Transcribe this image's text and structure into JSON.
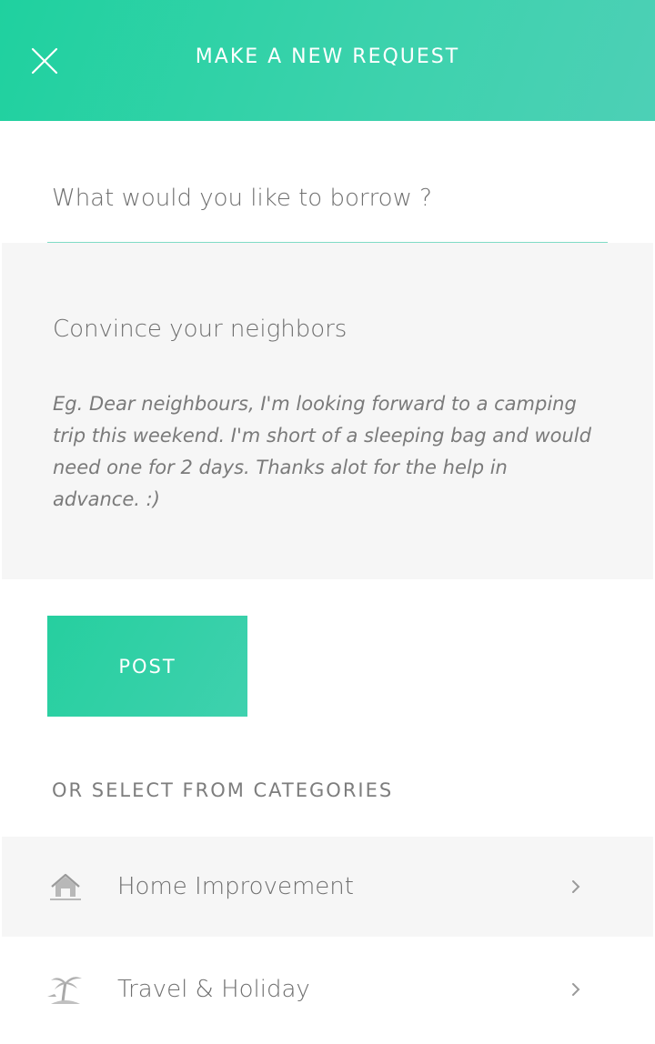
{
  "header": {
    "title": "MAKE A NEW REQUEST",
    "close_icon": "close-icon",
    "gradient_start": "#1fd19f",
    "gradient_end": "#4dd0b6"
  },
  "form": {
    "borrow_placeholder": "What would you like to borrow ?",
    "borrow_value": "",
    "message_title": "Convince your neighbors",
    "message_placeholder": "Eg. Dear neighbours, I'm looking forward to a camping trip this weekend. I'm short of a sleeping bag and would need one for 2 days. Thanks alot for the help in advance. :)",
    "post_label": "POST"
  },
  "categories": {
    "heading": "OR SELECT FROM CATEGORIES",
    "items": [
      {
        "label": "Home Improvement",
        "icon": "house-icon"
      },
      {
        "label": "Travel & Holiday",
        "icon": "palm-tree-icon"
      }
    ]
  },
  "colors": {
    "accent": "#2dd0a5",
    "panel_bg": "#f6f6f6",
    "text": "#6f6f6f"
  }
}
